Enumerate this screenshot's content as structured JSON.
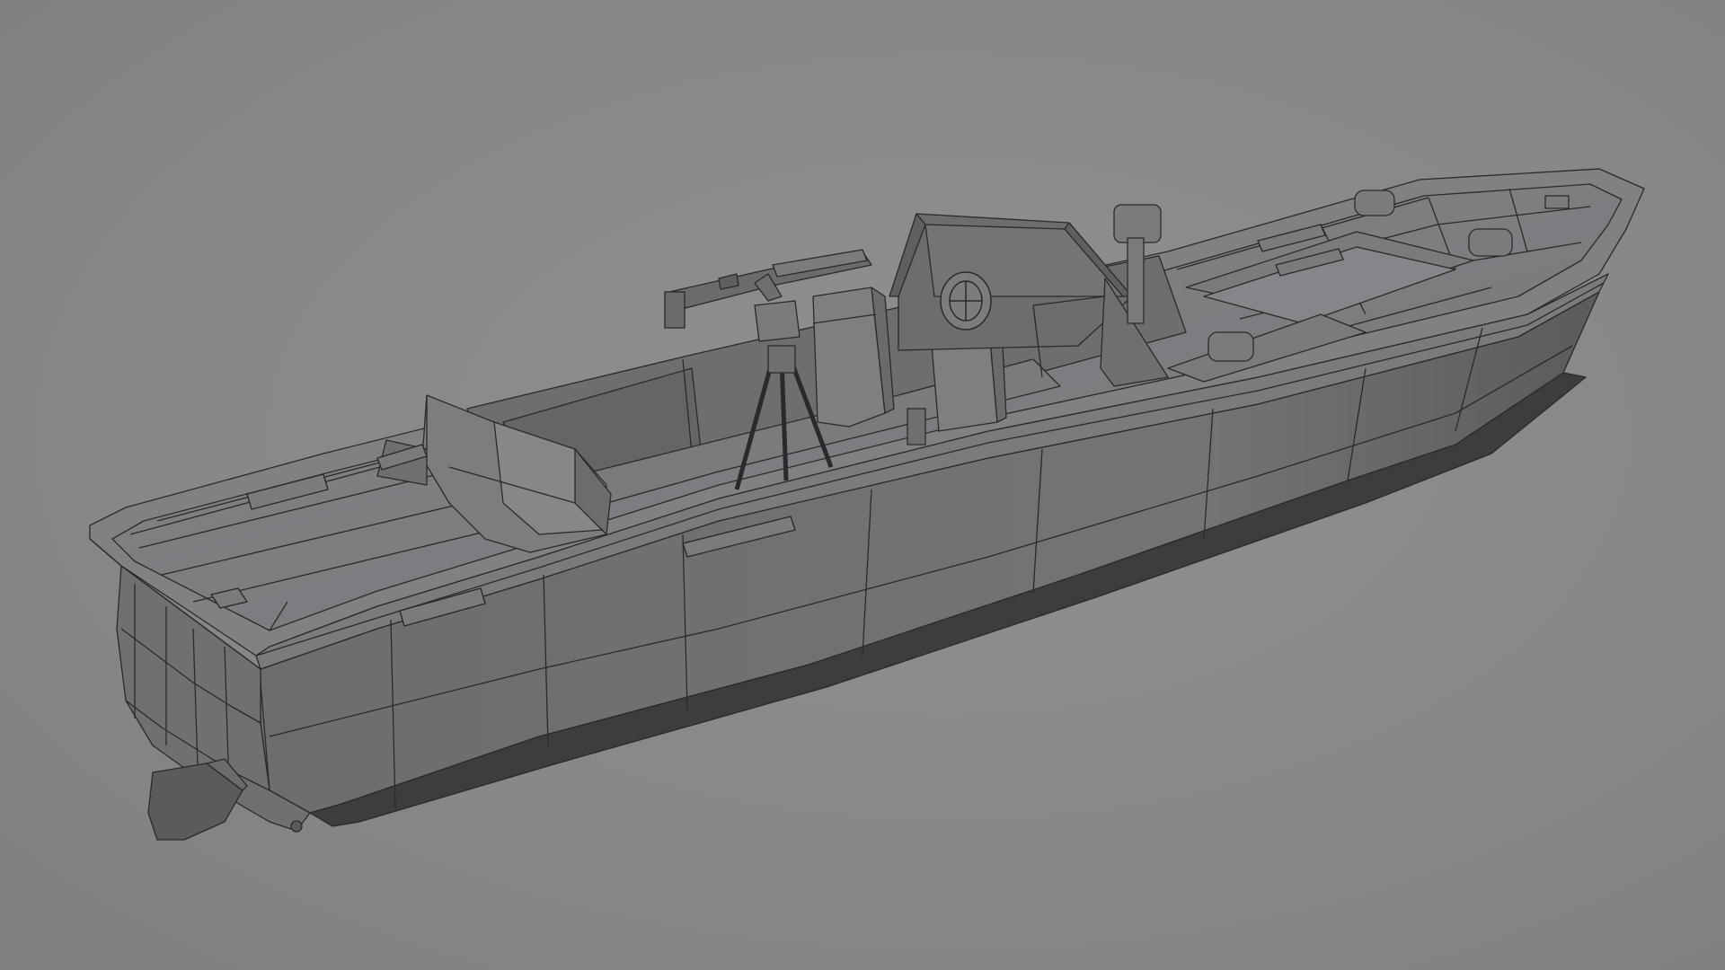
{
  "scene": {
    "subject": "boat-model-wireframe-render",
    "background_color": "#88898b",
    "hull_color": "#6f7072",
    "deck_color": "#7c7d7f",
    "edge_color": "#2a2a2a"
  }
}
